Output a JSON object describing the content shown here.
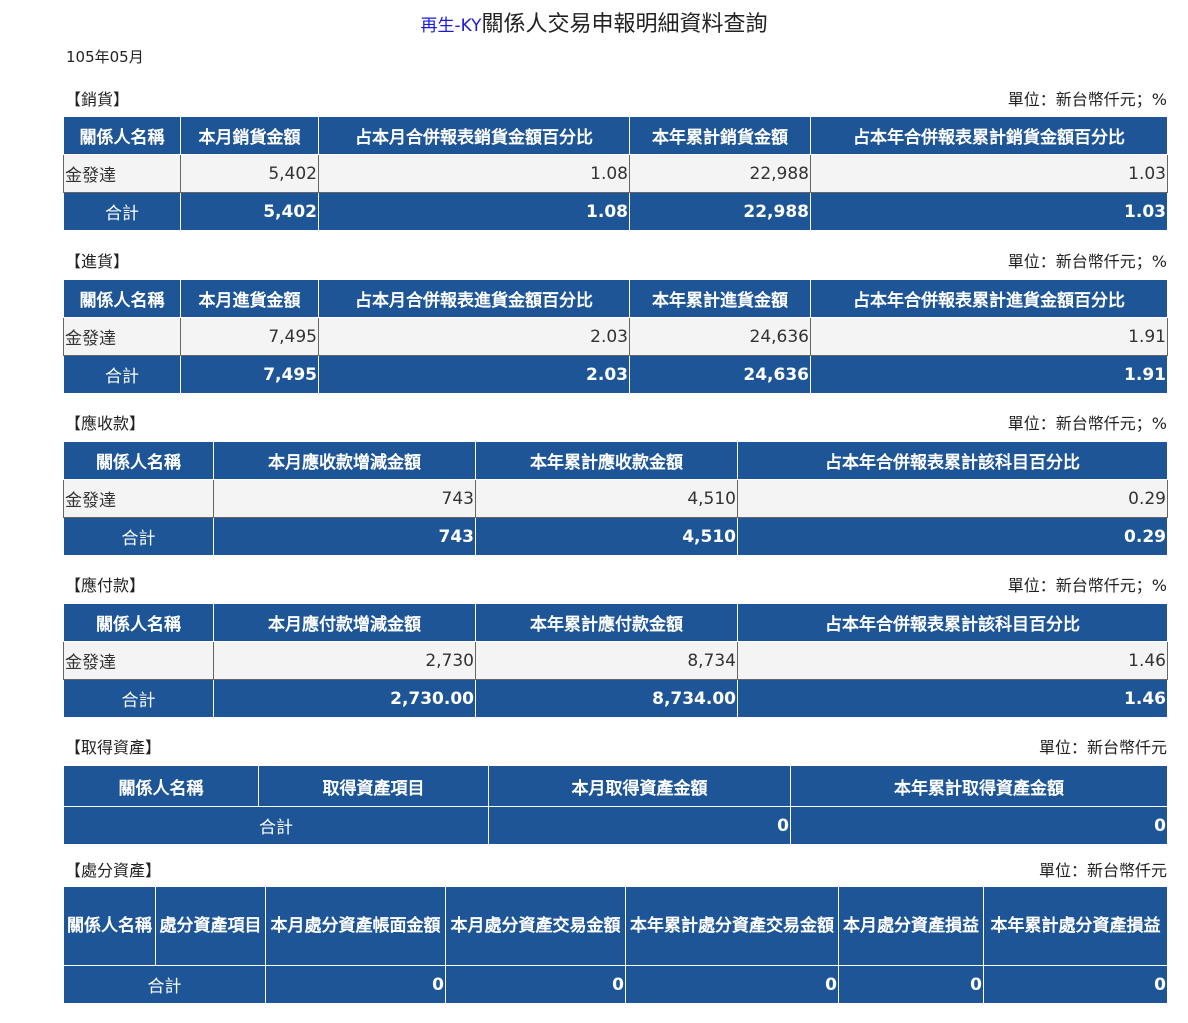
{
  "title": {
    "company": "再生-KY",
    "text": "關係人交易申報明細資料查詢"
  },
  "period": "105年05月",
  "sales": {
    "heading": "【銷貨】",
    "unit": "單位：新台幣仟元；%",
    "headers": [
      "關係人名稱",
      "本月銷貨金額",
      "占本月合併報表銷貨金額百分比",
      "本年累計銷貨金額",
      "占本年合併報表累計銷貨金額百分比"
    ],
    "row": [
      "金發達",
      "5,402",
      "1.08",
      "22,988",
      "1.03"
    ],
    "total": [
      "合計",
      "5,402",
      "1.08",
      "22,988",
      "1.03"
    ]
  },
  "purchases": {
    "heading": "【進貨】",
    "unit": "單位：新台幣仟元；%",
    "headers": [
      "關係人名稱",
      "本月進貨金額",
      "占本月合併報表進貨金額百分比",
      "本年累計進貨金額",
      "占本年合併報表累計進貨金額百分比"
    ],
    "row": [
      "金發達",
      "7,495",
      "2.03",
      "24,636",
      "1.91"
    ],
    "total": [
      "合計",
      "7,495",
      "2.03",
      "24,636",
      "1.91"
    ]
  },
  "receivables": {
    "heading": "【應收款】",
    "unit": "單位：新台幣仟元；%",
    "headers": [
      "關係人名稱",
      "本月應收款增減金額",
      "本年累計應收款金額",
      "占本年合併報表累計該科目百分比"
    ],
    "row": [
      "金發達",
      "743",
      "4,510",
      "0.29"
    ],
    "total": [
      "合計",
      "743",
      "4,510",
      "0.29"
    ]
  },
  "payables": {
    "heading": "【應付款】",
    "unit": "單位：新台幣仟元；%",
    "headers": [
      "關係人名稱",
      "本月應付款增減金額",
      "本年累計應付款金額",
      "占本年合併報表累計該科目百分比"
    ],
    "row": [
      "金發達",
      "2,730",
      "8,734",
      "1.46"
    ],
    "total": [
      "合計",
      "2,730.00",
      "8,734.00",
      "1.46"
    ]
  },
  "acquisition": {
    "heading": "【取得資產】",
    "unit": "單位：新台幣仟元",
    "headers": [
      "關係人名稱",
      "取得資產項目",
      "本月取得資產金額",
      "本年累計取得資產金額"
    ],
    "total": [
      "合計",
      "0",
      "0"
    ]
  },
  "disposal": {
    "heading": "【處分資產】",
    "unit": "單位：新台幣仟元",
    "headers": [
      "關係人名稱",
      "處分資產項目",
      "本月處分資產帳面金額",
      "本月處分資產交易金額",
      "本年累計處分資產交易金額",
      "本月處分資產損益",
      "本年累計處分資產損益"
    ],
    "total": [
      "合計",
      "0",
      "0",
      "0",
      "0",
      "0"
    ]
  }
}
